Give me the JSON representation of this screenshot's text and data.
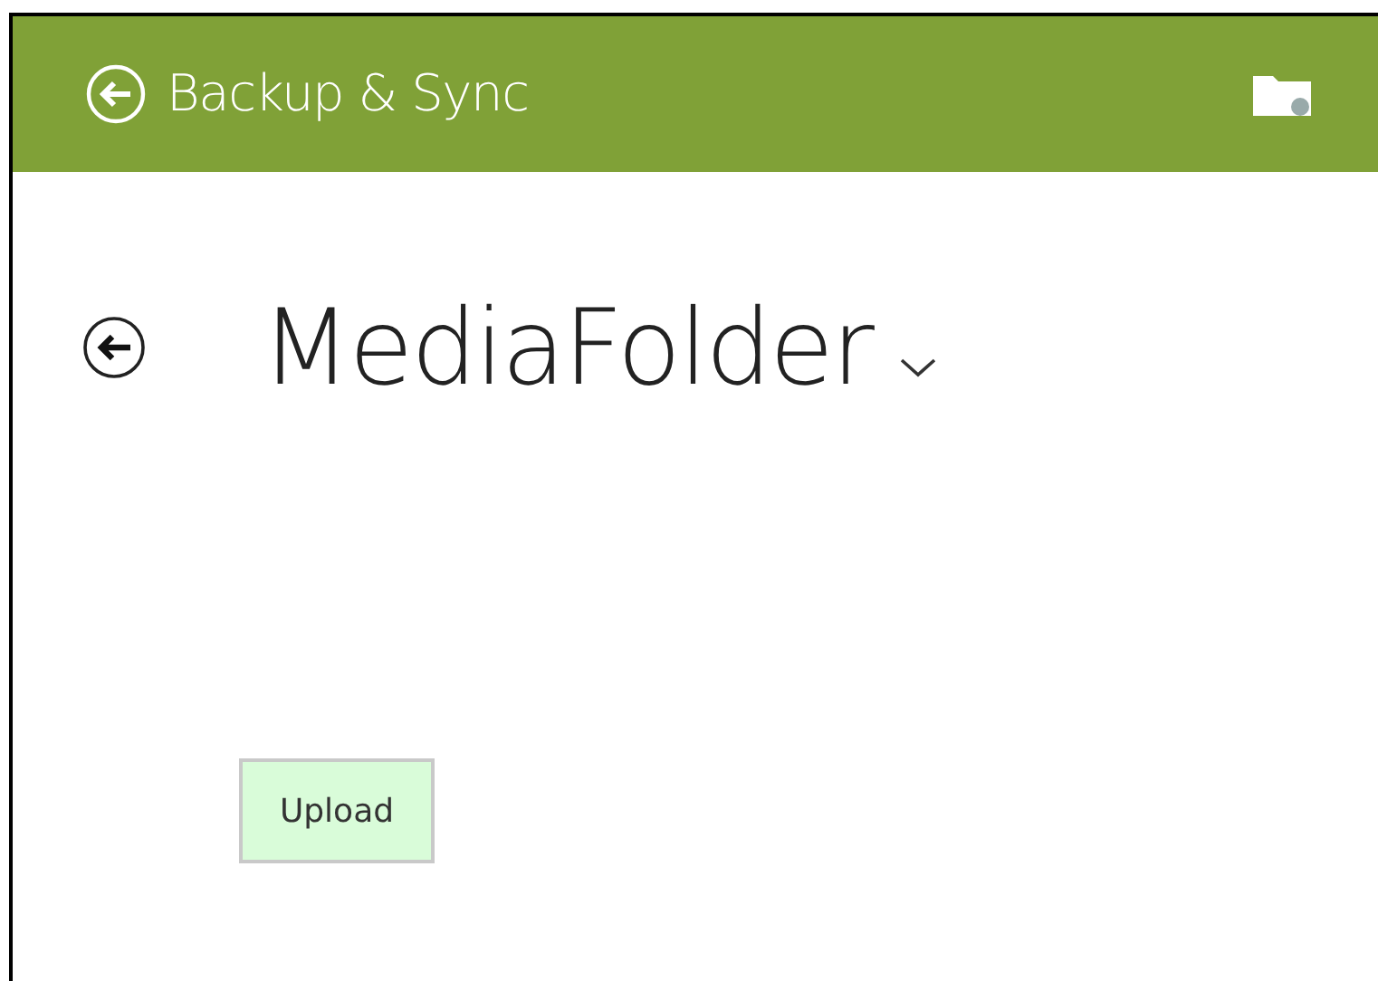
{
  "app_bar": {
    "title": "Backup & Sync"
  },
  "page": {
    "title": "MediaFolder"
  },
  "buttons": [
    {
      "label": "Upload"
    }
  ]
}
